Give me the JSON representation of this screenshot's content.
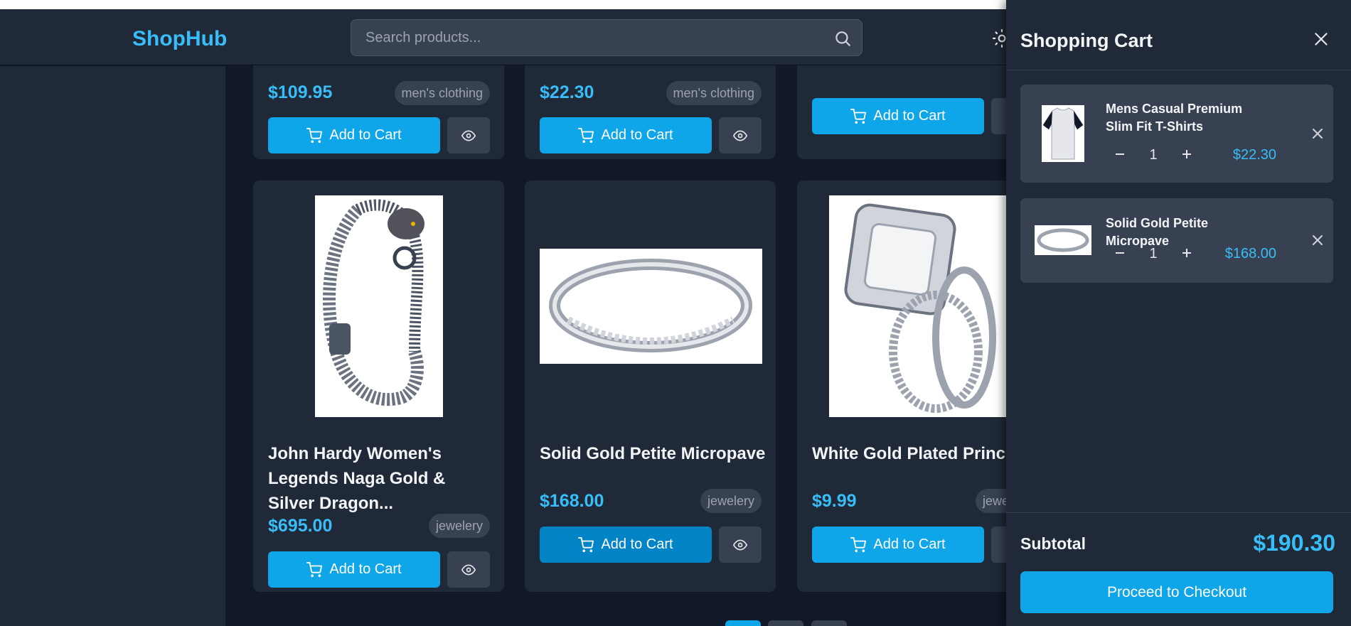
{
  "header": {
    "brand": "ShopHub",
    "search_placeholder": "Search products...",
    "search_icon": "search-icon",
    "theme_icon": "sun-icon"
  },
  "products_top_row": [
    {
      "price": "$109.95",
      "category": "men's clothing",
      "add_label": "Add to Cart"
    },
    {
      "price": "$22.30",
      "category": "men's clothing",
      "add_label": "Add to Cart"
    },
    {
      "price": "",
      "category": "",
      "add_label": "Add to Cart"
    }
  ],
  "products": [
    {
      "title": "John Hardy Women's Legends Naga Gold & Silver Dragon...",
      "price": "$695.00",
      "category": "jewelery",
      "add_label": "Add to Cart"
    },
    {
      "title": "Solid Gold Petite Micropave",
      "price": "$168.00",
      "category": "jewelery",
      "add_label": "Add to Cart"
    },
    {
      "title": "White Gold Plated Princess",
      "price": "$9.99",
      "category": "jewe",
      "add_label": "Add to Cart"
    }
  ],
  "cart": {
    "title": "Shopping Cart",
    "items": [
      {
        "name": "Mens Casual Premium Slim Fit T-Shirts",
        "qty": "1",
        "price": "$22.30",
        "minus": "−",
        "plus": "+"
      },
      {
        "name": "Solid Gold Petite Micropave",
        "qty": "1",
        "price": "$168.00",
        "minus": "−",
        "plus": "+"
      }
    ],
    "subtotal_label": "Subtotal",
    "subtotal_value": "$190.30",
    "checkout_label": "Proceed to Checkout"
  },
  "colors": {
    "accent": "#0ea5e9",
    "price": "#38bdf8",
    "background": "#111827",
    "surface": "#1f2937"
  }
}
